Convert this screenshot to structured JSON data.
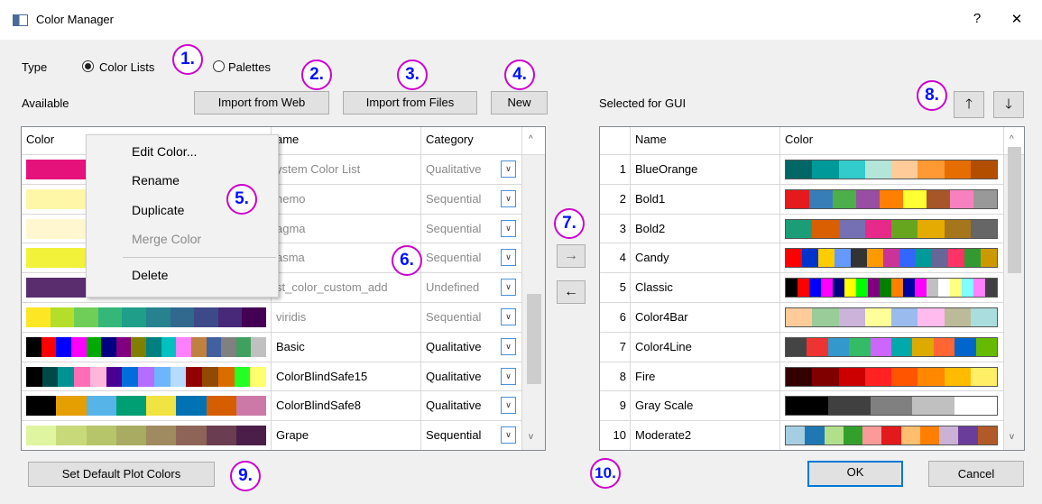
{
  "window": {
    "title": "Color Manager",
    "help": "?",
    "close": "✕"
  },
  "type_label": "Type",
  "radio": {
    "color_lists": "Color Lists",
    "palettes": "Palettes"
  },
  "available_label": "Available",
  "selected_label": "Selected for GUI",
  "buttons": {
    "import_web": "Import from Web",
    "import_files": "Import from Files",
    "new": "New",
    "set_default": "Set Default Plot Colors",
    "ok": "OK",
    "cancel": "Cancel",
    "move_right": "→",
    "move_left": "←",
    "move_up": "🡑",
    "move_down": "🡓"
  },
  "markers": [
    "1.",
    "2.",
    "3.",
    "4.",
    "5.",
    "6.",
    "7.",
    "8.",
    "9.",
    "10."
  ],
  "left_table": {
    "headers": {
      "color": "Color",
      "name": "ame",
      "category": "Category"
    },
    "rows": [
      {
        "name": "ystem Color List",
        "category": "Qualitative",
        "gray": true,
        "colors": [
          "#e5127c",
          "#f5454a",
          "#f08a3c"
        ]
      },
      {
        "name": "nemo",
        "category": "Sequential",
        "gray": true,
        "colors": [
          "#fff7a8",
          "#fcd36a",
          "#f5b247"
        ]
      },
      {
        "name": "agma",
        "category": "Sequential",
        "gray": true,
        "colors": [
          "#fff7d0",
          "#fcc89b",
          "#f7a77a"
        ]
      },
      {
        "name": "asma",
        "category": "Sequential",
        "gray": true,
        "colors": [
          "#f2f23a",
          "#f0c22e",
          "#e8a532"
        ]
      },
      {
        "name": "st_color_custom_add",
        "category": "Undefined",
        "gray": true,
        "colors": [
          "#5a2e6e",
          "#b8b83a"
        ]
      },
      {
        "name": "viridis",
        "category": "Sequential",
        "gray": true,
        "colors": [
          "#fde725",
          "#b5de2b",
          "#6ece58",
          "#35b779",
          "#1f9e89",
          "#26828e",
          "#31688e",
          "#3e4989",
          "#482878",
          "#440154"
        ]
      },
      {
        "name": "Basic",
        "category": "Qualitative",
        "gray": false,
        "colors": [
          "#000000",
          "#ff0000",
          "#0000ff",
          "#ff00ff",
          "#00aa00",
          "#000080",
          "#800080",
          "#808000",
          "#008080",
          "#00c0c0",
          "#ff80ff",
          "#c08040",
          "#4060a0",
          "#808080",
          "#40a060",
          "#c0c0c0"
        ]
      },
      {
        "name": "ColorBlindSafe15",
        "category": "Qualitative",
        "gray": false,
        "colors": [
          "#000000",
          "#004949",
          "#009292",
          "#ff6db6",
          "#ffb6db",
          "#490092",
          "#006ddb",
          "#b66dff",
          "#6db6ff",
          "#b6dbff",
          "#920000",
          "#924900",
          "#db6d00",
          "#24ff24",
          "#ffff6d"
        ]
      },
      {
        "name": "ColorBlindSafe8",
        "category": "Qualitative",
        "gray": false,
        "colors": [
          "#000000",
          "#e69f00",
          "#56b4e9",
          "#009e73",
          "#f0e442",
          "#0072b2",
          "#d55e00",
          "#cc79a7"
        ]
      },
      {
        "name": "Grape",
        "category": "Sequential",
        "gray": false,
        "colors": [
          "#e0f5a0",
          "#c8d97a",
          "#b6c46a",
          "#a8ab62",
          "#a08a60",
          "#8e6458",
          "#6a3e50",
          "#4a1e48"
        ]
      }
    ]
  },
  "context_menu": [
    {
      "label": "Edit Color...",
      "enabled": true
    },
    {
      "label": "Rename",
      "enabled": true
    },
    {
      "label": "Duplicate",
      "enabled": true
    },
    {
      "label": "Merge Color",
      "enabled": false
    },
    {
      "label": "Delete",
      "enabled": true
    }
  ],
  "right_table": {
    "headers": {
      "name": "Name",
      "color": "Color"
    },
    "rows": [
      {
        "num": "1",
        "name": "BlueOrange",
        "colors": [
          "#006666",
          "#009999",
          "#33cccc",
          "#b3e5d9",
          "#ffcc99",
          "#ff9933",
          "#e66e00",
          "#b34d00"
        ]
      },
      {
        "num": "2",
        "name": "Bold1",
        "colors": [
          "#e41a1c",
          "#377eb8",
          "#4daf4a",
          "#984ea3",
          "#ff7f00",
          "#ffff33",
          "#a65628",
          "#f781bf",
          "#999999"
        ]
      },
      {
        "num": "3",
        "name": "Bold2",
        "colors": [
          "#1b9e77",
          "#d95f02",
          "#7570b3",
          "#e7298a",
          "#66a61e",
          "#e6ab02",
          "#a6761d",
          "#666666"
        ]
      },
      {
        "num": "4",
        "name": "Candy",
        "colors": [
          "#ff0000",
          "#0033cc",
          "#ffcc00",
          "#6699ff",
          "#333333",
          "#ff9900",
          "#cc3399",
          "#3366ff",
          "#009999",
          "#666699",
          "#ff3366",
          "#339933",
          "#cc9900"
        ]
      },
      {
        "num": "5",
        "name": "Classic",
        "colors": [
          "#000000",
          "#ff0000",
          "#0000ff",
          "#ff00ff",
          "#000080",
          "#ffff00",
          "#00ff00",
          "#800080",
          "#008000",
          "#ff8000",
          "#0000a0",
          "#ff00ff",
          "#c0c0c0",
          "#ffffff",
          "#ffff80",
          "#80ffff",
          "#ff80ff",
          "#404040"
        ]
      },
      {
        "num": "6",
        "name": "Color4Bar",
        "colors": [
          "#ffcc99",
          "#99cc99",
          "#ccb3d9",
          "#ffff99",
          "#99bbee",
          "#ffbbee",
          "#bbbb99",
          "#aadddd"
        ]
      },
      {
        "num": "7",
        "name": "Color4Line",
        "colors": [
          "#444444",
          "#ee3333",
          "#3399cc",
          "#33bb66",
          "#cc66ff",
          "#00aaaa",
          "#ddaa00",
          "#ff6633",
          "#0066cc",
          "#66bb00"
        ]
      },
      {
        "num": "8",
        "name": "Fire",
        "colors": [
          "#330000",
          "#800000",
          "#cc0000",
          "#ff2222",
          "#ff5500",
          "#ff8800",
          "#ffbb00",
          "#ffee66"
        ]
      },
      {
        "num": "9",
        "name": "Gray Scale",
        "colors": [
          "#000000",
          "#404040",
          "#808080",
          "#c0c0c0",
          "#ffffff"
        ]
      },
      {
        "num": "10",
        "name": "Moderate2",
        "colors": [
          "#a6cee3",
          "#1f78b4",
          "#b2df8a",
          "#33a02c",
          "#fb9a99",
          "#e31a1c",
          "#fdbf6f",
          "#ff7f00",
          "#cab2d6",
          "#6a3d9a",
          "#b15928"
        ]
      }
    ]
  },
  "scroll_up": "^",
  "scroll_down": "v"
}
